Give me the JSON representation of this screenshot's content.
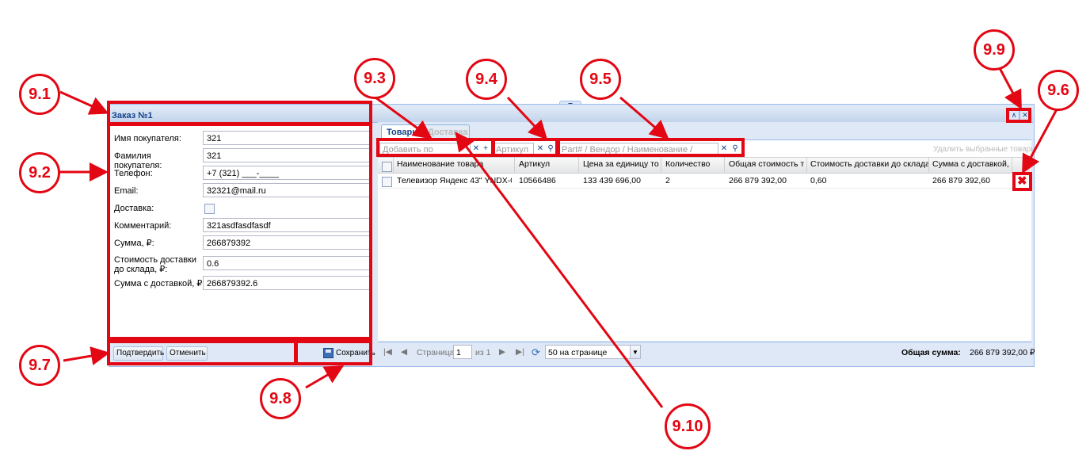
{
  "window": {
    "title": "Заказ №1"
  },
  "form": {
    "fields": [
      {
        "label": "Имя покупателя:",
        "value": "321"
      },
      {
        "label": "Фамилия покупателя:",
        "value": "321"
      },
      {
        "label": "Телефон:",
        "value": "+7 (321) ___-____"
      },
      {
        "label": "Email:",
        "value": "32321@mail.ru"
      },
      {
        "label": "Доставка:",
        "value": ""
      },
      {
        "label": "Комментарий:",
        "value": "321asdfasdfasdf"
      },
      {
        "label": "Сумма, ₽:",
        "value": "266879392"
      },
      {
        "label": "Стоимость доставки до склада, ₽:",
        "value": "0.6"
      },
      {
        "label": "Сумма с доставкой, ₽:",
        "value": "266879392.6"
      }
    ],
    "delivery_checked": false,
    "buttons": {
      "confirm": "Подтвердить",
      "cancel": "Отменить",
      "save": "Сохранить"
    }
  },
  "tabs": [
    {
      "label": "Товары",
      "active": true
    },
    {
      "label": "Доставка",
      "active": false
    }
  ],
  "toolbar": {
    "add_by_sku_placeholder": "Добавить по артикулу",
    "sku_placeholder": "Артикул",
    "search_placeholder": "Part# / Вендор / Наименование / Штрихкод",
    "delete_selected": "Удалить выбранные товары"
  },
  "grid": {
    "columns": [
      "Наименование товара",
      "Артикул",
      "Цена за единицу то...",
      "Количество",
      "Общая стоимость то...",
      "Стоимость доставки до склада, ₽",
      "Сумма с доставкой, ₽"
    ],
    "rows": [
      {
        "name": "Телевизор Яндекс 43\" YNDX-000...",
        "sku": "10566486",
        "price": "133 439 696,00",
        "qty": "2",
        "total": "266 879 392,00",
        "delivery": "0,60",
        "sum": "266 879 392,60"
      }
    ]
  },
  "pager": {
    "page_label": "Страница",
    "page_value": "1",
    "of_label": "из 1",
    "per_page": "50 на странице",
    "total_label": "Общая сумма:",
    "total_value": "266 879 392,00 ₽"
  },
  "annotations": {
    "a91": "9.1",
    "a92": "9.2",
    "a93": "9.3",
    "a94": "9.4",
    "a95": "9.5",
    "a96": "9.6",
    "a97": "9.7",
    "a98": "9.8",
    "a99": "9.9",
    "a910": "9.10"
  },
  "colors": {
    "annotation": "#e30613",
    "panel_bg": "#dfe8f6",
    "title_text": "#15428b",
    "border": "#99bbe8"
  }
}
